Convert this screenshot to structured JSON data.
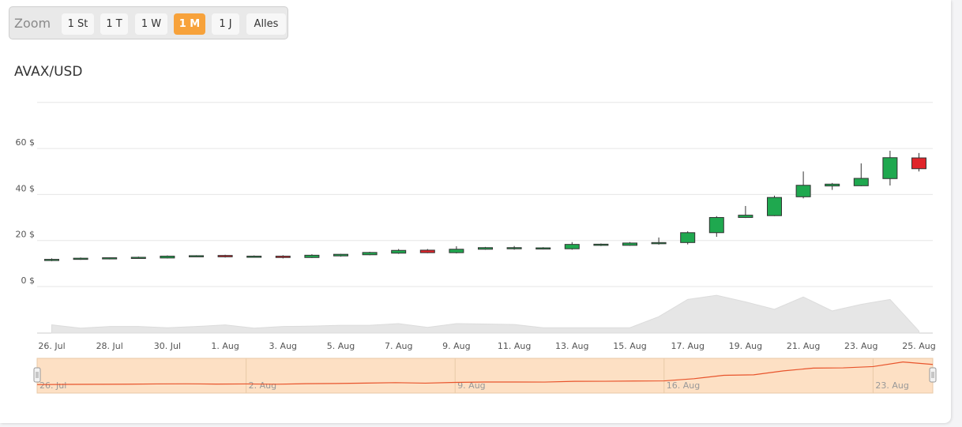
{
  "zoom": {
    "label": "Zoom",
    "buttons": [
      "1 St",
      "1 T",
      "1 W",
      "1 M",
      "1 J",
      "Alles"
    ],
    "active_index": 3,
    "active_color": "#f7a23b"
  },
  "chart_data": {
    "type": "candlestick",
    "title": "AVAX/USD",
    "y_ticks": [
      "0 $",
      "20 $",
      "40 $",
      "60 $"
    ],
    "ylim": [
      0,
      80
    ],
    "x_ticks": [
      "26. Jul",
      "28. Jul",
      "30. Jul",
      "1. Aug",
      "3. Aug",
      "5. Aug",
      "7. Aug",
      "9. Aug",
      "11. Aug",
      "13. Aug",
      "15. Aug",
      "17. Aug",
      "19. Aug",
      "21. Aug",
      "23. Aug",
      "25. Aug"
    ],
    "dates": [
      "26. Jul",
      "27. Jul",
      "28. Jul",
      "29. Jul",
      "30. Jul",
      "31. Jul",
      "1. Aug",
      "2. Aug",
      "3. Aug",
      "4. Aug",
      "5. Aug",
      "6. Aug",
      "7. Aug",
      "8. Aug",
      "9. Aug",
      "10. Aug",
      "11. Aug",
      "12. Aug",
      "13. Aug",
      "14. Aug",
      "15. Aug",
      "16. Aug",
      "17. Aug",
      "18. Aug",
      "19. Aug",
      "20. Aug",
      "21. Aug",
      "22. Aug",
      "23. Aug",
      "24. Aug",
      "25. Aug"
    ],
    "candles": [
      {
        "o": 11.5,
        "h": 12.2,
        "l": 11.0,
        "c": 11.8
      },
      {
        "o": 11.8,
        "h": 12.6,
        "l": 11.6,
        "c": 12.3
      },
      {
        "o": 12.1,
        "h": 12.6,
        "l": 11.8,
        "c": 12.5
      },
      {
        "o": 12.5,
        "h": 13.0,
        "l": 12.3,
        "c": 12.7
      },
      {
        "o": 12.4,
        "h": 13.5,
        "l": 12.2,
        "c": 13.2
      },
      {
        "o": 13.2,
        "h": 13.6,
        "l": 12.9,
        "c": 13.4
      },
      {
        "o": 13.5,
        "h": 13.8,
        "l": 12.6,
        "c": 12.9
      },
      {
        "o": 13.0,
        "h": 13.5,
        "l": 12.7,
        "c": 13.2
      },
      {
        "o": 13.2,
        "h": 13.6,
        "l": 12.2,
        "c": 12.6
      },
      {
        "o": 12.6,
        "h": 14.0,
        "l": 12.4,
        "c": 13.6
      },
      {
        "o": 13.3,
        "h": 14.2,
        "l": 13.0,
        "c": 14.0
      },
      {
        "o": 13.8,
        "h": 15.1,
        "l": 13.6,
        "c": 14.8
      },
      {
        "o": 14.5,
        "h": 16.3,
        "l": 14.2,
        "c": 15.7
      },
      {
        "o": 15.8,
        "h": 16.3,
        "l": 14.5,
        "c": 14.7
      },
      {
        "o": 14.7,
        "h": 17.5,
        "l": 14.4,
        "c": 16.2
      },
      {
        "o": 16.2,
        "h": 17.2,
        "l": 16.0,
        "c": 16.9
      },
      {
        "o": 16.7,
        "h": 17.6,
        "l": 16.0,
        "c": 16.9
      },
      {
        "o": 16.6,
        "h": 17.1,
        "l": 16.1,
        "c": 16.8
      },
      {
        "o": 16.4,
        "h": 19.3,
        "l": 16.0,
        "c": 18.3
      },
      {
        "o": 18.2,
        "h": 18.7,
        "l": 17.6,
        "c": 18.4
      },
      {
        "o": 17.9,
        "h": 19.3,
        "l": 17.7,
        "c": 18.9
      },
      {
        "o": 18.7,
        "h": 21.3,
        "l": 18.2,
        "c": 19.1
      },
      {
        "o": 19.1,
        "h": 24.0,
        "l": 18.3,
        "c": 23.4
      },
      {
        "o": 23.4,
        "h": 30.6,
        "l": 21.6,
        "c": 30.0
      },
      {
        "o": 30.0,
        "h": 35.0,
        "l": 29.8,
        "c": 31.0
      },
      {
        "o": 30.8,
        "h": 39.5,
        "l": 30.6,
        "c": 38.7
      },
      {
        "o": 39.0,
        "h": 50.0,
        "l": 38.3,
        "c": 44.0
      },
      {
        "o": 43.7,
        "h": 45.0,
        "l": 42.0,
        "c": 44.5
      },
      {
        "o": 43.8,
        "h": 53.5,
        "l": 43.6,
        "c": 47.0
      },
      {
        "o": 46.9,
        "h": 59.0,
        "l": 43.9,
        "c": 56.0
      },
      {
        "o": 55.9,
        "h": 58.0,
        "l": 50.0,
        "c": 51.2
      }
    ],
    "volume": [
      0.2,
      0.12,
      0.16,
      0.16,
      0.13,
      0.16,
      0.2,
      0.12,
      0.16,
      0.17,
      0.19,
      0.19,
      0.23,
      0.14,
      0.23,
      0.22,
      0.21,
      0.13,
      0.13,
      0.13,
      0.13,
      0.4,
      0.82,
      0.92,
      0.76,
      0.58,
      0.88,
      0.54,
      0.7,
      0.82,
      0.05
    ],
    "navigator": {
      "labels": [
        "26. Jul",
        "2. Aug",
        "9. Aug",
        "16. Aug",
        "23. Aug"
      ],
      "line_values": [
        11.8,
        12.3,
        12.5,
        12.7,
        13.2,
        13.4,
        12.9,
        13.2,
        12.6,
        13.6,
        14.0,
        14.8,
        15.7,
        14.7,
        16.2,
        16.9,
        16.9,
        16.8,
        18.3,
        18.4,
        18.9,
        19.1,
        23.4,
        30.0,
        31.0,
        38.7,
        44.0,
        44.5,
        47.0,
        56.0,
        51.2
      ]
    },
    "colors": {
      "up": "#1fa84f",
      "down": "#e0242a",
      "volume": "#e6e6e6",
      "navigator_fill": "#fde0c4",
      "navigator_line": "#e8542c"
    }
  }
}
